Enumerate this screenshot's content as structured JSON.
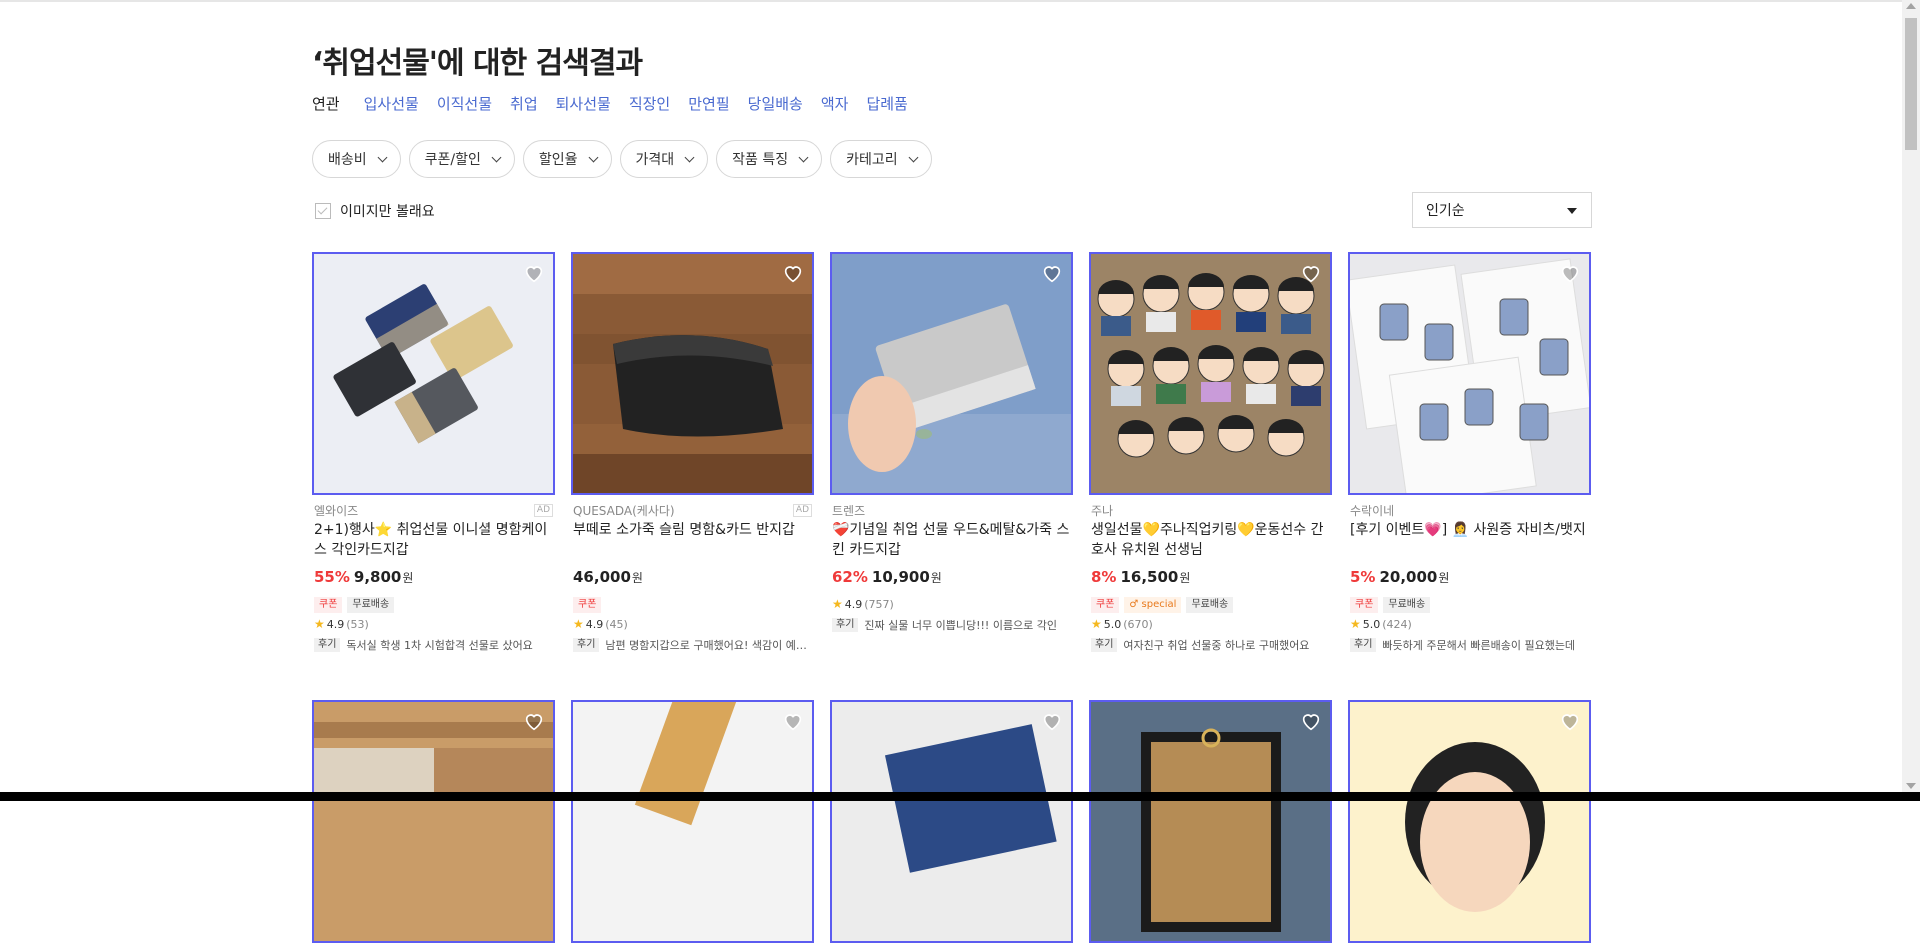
{
  "search": {
    "title": "‘취업선물'에 대한 검색결과",
    "related_label": "연관",
    "related": [
      "입사선물",
      "이직선물",
      "취업",
      "퇴사선물",
      "직장인",
      "만연필",
      "당일배송",
      "액자",
      "답례품"
    ]
  },
  "filters": [
    "배송비",
    "쿠폰/할인",
    "할인율",
    "가격대",
    "작품 특징",
    "카테고리"
  ],
  "image_only_label": "이미지만 볼래요",
  "sort": {
    "selected": "인기순"
  },
  "products": [
    {
      "seller": "엘와이즈",
      "ad": "AD",
      "name": "2+1)행사⭐ 취업선물 이니셜 명함케이스 각인카드지갑",
      "discount": "55%",
      "price": "9,800",
      "currency": "원",
      "badges": [
        "쿠폰",
        "무료배송"
      ],
      "rating": "4.9",
      "review_count": "(53)",
      "review_tag": "후기",
      "review": "독서실 학생 1차 시험합격 선물로 샀어요"
    },
    {
      "seller": "QUESADA(케사다)",
      "ad": "AD",
      "name": "부떼로 소가죽 슬림 명함&카드 반지갑",
      "discount": "",
      "price": "46,000",
      "currency": "원",
      "badges": [
        "쿠폰"
      ],
      "rating": "4.9",
      "review_count": "(45)",
      "review_tag": "후기",
      "review": "남편 명함지갑으로 구매했어요! 색감이 예뻐요"
    },
    {
      "seller": "트렌즈",
      "ad": "",
      "name": "❤️‍🩹기념일 취업 선물 우드&메탈&가죽 스킨 카드지갑",
      "discount": "62%",
      "price": "10,900",
      "currency": "원",
      "badges": [],
      "rating": "4.9",
      "review_count": "(757)",
      "review_tag": "후기",
      "review": "진짜 실물 너무 이쁩니당!!! 이름으로 각인"
    },
    {
      "seller": "주나",
      "ad": "",
      "name": "생일선물💛주나직업키링💛운동선수 간호사 유치원 선생님",
      "discount": "8%",
      "price": "16,500",
      "currency": "원",
      "badges": [
        "쿠폰",
        "♂ special",
        "무료배송"
      ],
      "rating": "5.0",
      "review_count": "(670)",
      "review_tag": "후기",
      "review": "여자친구 취업 선물중 하나로 구매했어요"
    },
    {
      "seller": "수락이네",
      "ad": "",
      "name": "[후기 이벤트💗] 👩‍💼 사원증 자비츠/뱃지",
      "discount": "5%",
      "price": "20,000",
      "currency": "원",
      "badges": [
        "쿠폰",
        "무료배송"
      ],
      "rating": "5.0",
      "review_count": "(424)",
      "review_tag": "후기",
      "review": "빠듯하게 주문해서 빠른배송이 필요했는데"
    }
  ]
}
